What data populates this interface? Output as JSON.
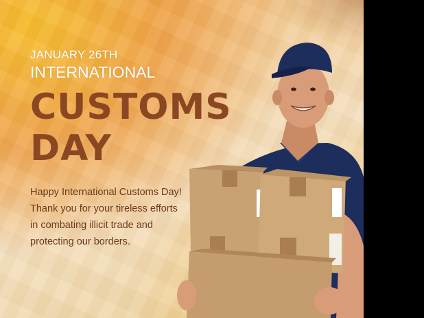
{
  "poster": {
    "date": "JANUARY 26TH",
    "subtitle": "INTERNATIONAL",
    "title_line1": "CUSTOMS",
    "title_line2": "DAY",
    "message_lines": [
      "Happy International Customs Day!",
      "Thank you for your tireless efforts",
      "in combating illicit trade and",
      "protecting our borders."
    ]
  },
  "colors": {
    "title": "#8b4722",
    "body_text": "#6b3a1c",
    "highlight_text": "#ffffff",
    "cap_and_shirt": "#1d2d5c",
    "box": "#c9a274"
  },
  "image": {
    "subject": "delivery-man-holding-cardboard-boxes"
  }
}
